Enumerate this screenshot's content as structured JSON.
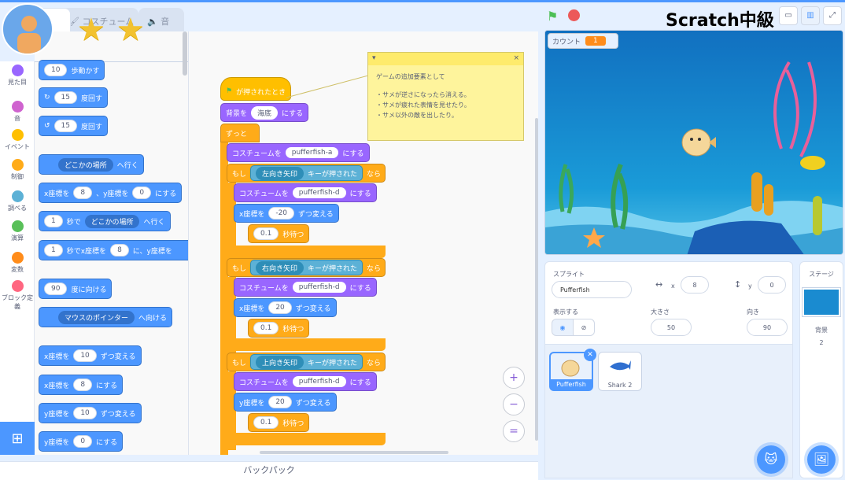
{
  "tabs": [
    "",
    "コスチューム",
    "音"
  ],
  "title": "Scratch中級",
  "categories": [
    {
      "label": "見た目",
      "color": "#9966ff"
    },
    {
      "label": "音",
      "color": "#cf63cf"
    },
    {
      "label": "イベント",
      "color": "#ffbf00"
    },
    {
      "label": "制御",
      "color": "#ffab19"
    },
    {
      "label": "調べる",
      "color": "#5cb1d6"
    },
    {
      "label": "演算",
      "color": "#59c059"
    },
    {
      "label": "変数",
      "color": "#ff8c1a"
    },
    {
      "label": "ブロック定義",
      "color": "#ff6680"
    }
  ],
  "palette": {
    "move": {
      "v": "10",
      "t": "歩動かす"
    },
    "turn_r": {
      "v": "15",
      "t": "度回す"
    },
    "turn_l": {
      "v": "15",
      "t": "度回す"
    },
    "goto": {
      "d": "どこかの場所",
      "t": "へ行く"
    },
    "gotoxy": {
      "a": "x座標を",
      "x": "8",
      "b": "、y座標を",
      "y": "0",
      "c": "にする"
    },
    "glide": {
      "v": "1",
      "a": "秒で",
      "d": "どこかの場所",
      "t": "へ行く"
    },
    "glidexy": {
      "v": "1",
      "a": "秒でx座標を",
      "x": "8",
      "b": "に、y座標を"
    },
    "point": {
      "v": "90",
      "t": "度に向ける"
    },
    "towards": {
      "d": "マウスのポインター",
      "t": "へ向ける"
    },
    "chx": {
      "a": "x座標を",
      "v": "10",
      "t": "ずつ変える"
    },
    "setx": {
      "a": "x座標を",
      "v": "8",
      "t": "にする"
    },
    "chy": {
      "a": "y座標を",
      "v": "10",
      "t": "ずつ変える"
    },
    "sety": {
      "a": "y座標を",
      "v": "0",
      "t": "にする"
    }
  },
  "script": {
    "hat": "が押されたとき",
    "backdrop": {
      "a": "背景を",
      "d": "海底",
      "t": "にする"
    },
    "forever": "ずっと",
    "c1": {
      "a": "コスチュームを",
      "d": "pufferfish-a",
      "t": "にする"
    },
    "if_word": "もし",
    "then_word": "なら",
    "key_pressed": "キーが押された",
    "k1": "左向き矢印",
    "k2": "右向き矢印",
    "k3": "上向き矢印",
    "cost": "コスチュームを",
    "costd": "pufferfish-d",
    "set": "にする",
    "xch": "x座標を",
    "ych": "y座標を",
    "by": "ずつ変える",
    "v1": "-20",
    "v2": "20",
    "v3": "20",
    "wait": "0.1",
    "wait_t": "秒待つ"
  },
  "note": {
    "head": "▾",
    "close": "×",
    "lines": [
      "ゲームの追加要素として",
      "",
      "・サメが逆さになったら消える。",
      "・サメが疲れた表情を見せたり。",
      "・サメ以外の敵を出したり。"
    ]
  },
  "backpack": "バックパック",
  "monitor": {
    "label": "カウント",
    "value": "1"
  },
  "sprite": {
    "label": "スプライト",
    "name": "Pufferfish",
    "x_label": "x",
    "x": "8",
    "y_label": "y",
    "y": "0",
    "show_label": "表示する",
    "size_label": "大きさ",
    "size": "50",
    "dir_label": "向き",
    "dir": "90"
  },
  "sprites": [
    "Pufferfish",
    "Shark 2"
  ],
  "stage": {
    "label": "ステージ",
    "backdrop_label": "背景",
    "backdrop_count": "2"
  },
  "colors": {
    "accent": "#4c97ff"
  }
}
